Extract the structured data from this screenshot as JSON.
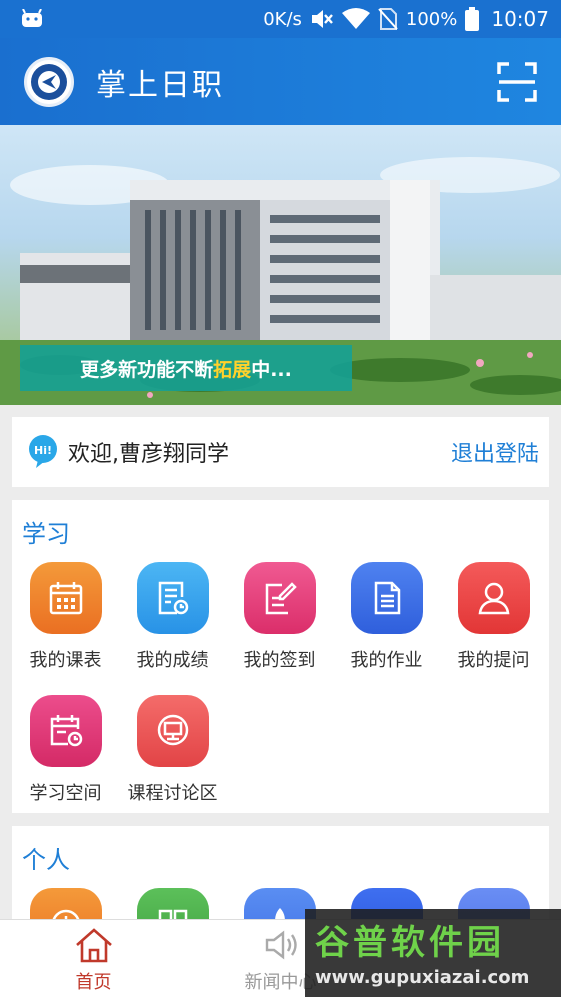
{
  "status_bar": {
    "speed": "0K/s",
    "battery": "100%",
    "time": "10:07"
  },
  "header": {
    "title": "掌上日职"
  },
  "banner": {
    "caption_prefix": "更多新功能不断",
    "caption_highlight": "拓展",
    "caption_suffix": "中..."
  },
  "welcome": {
    "greeting": "欢迎,曹彦翔同学",
    "logout": "退出登陆"
  },
  "study": {
    "title": "学习",
    "items": [
      {
        "label": "我的课表",
        "icon": "calendar-icon",
        "color": "#f08a2c"
      },
      {
        "label": "我的成绩",
        "icon": "report-icon",
        "color": "#3aa6f0"
      },
      {
        "label": "我的签到",
        "icon": "sign-in-icon",
        "color": "#e8467e"
      },
      {
        "label": "我的作业",
        "icon": "document-icon",
        "color": "#3f6fe6"
      },
      {
        "label": "我的提问",
        "icon": "user-question-icon",
        "color": "#f04848"
      },
      {
        "label": "学习空间",
        "icon": "schedule-icon",
        "color": "#e53a7a"
      },
      {
        "label": "课程讨论区",
        "icon": "discussion-icon",
        "color": "#f0585a"
      }
    ]
  },
  "personal": {
    "title": "个人",
    "items": [
      {
        "icon": "clock-icon",
        "color": "#f08a2c"
      },
      {
        "icon": "grid-icon",
        "color": "#4caf50"
      },
      {
        "icon": "rocket-icon",
        "color": "#4a7ef0"
      },
      {
        "icon": "bug-icon",
        "color": "#2f5fe0"
      },
      {
        "icon": "mail-icon",
        "color": "#5a7ef0"
      }
    ]
  },
  "tabs": [
    {
      "label": "首页",
      "icon": "home-icon",
      "active": true
    },
    {
      "label": "新闻中心",
      "icon": "speaker-icon",
      "active": false
    }
  ],
  "watermark": {
    "title": "谷普软件园",
    "url": "www.gupuxiazai.com"
  }
}
